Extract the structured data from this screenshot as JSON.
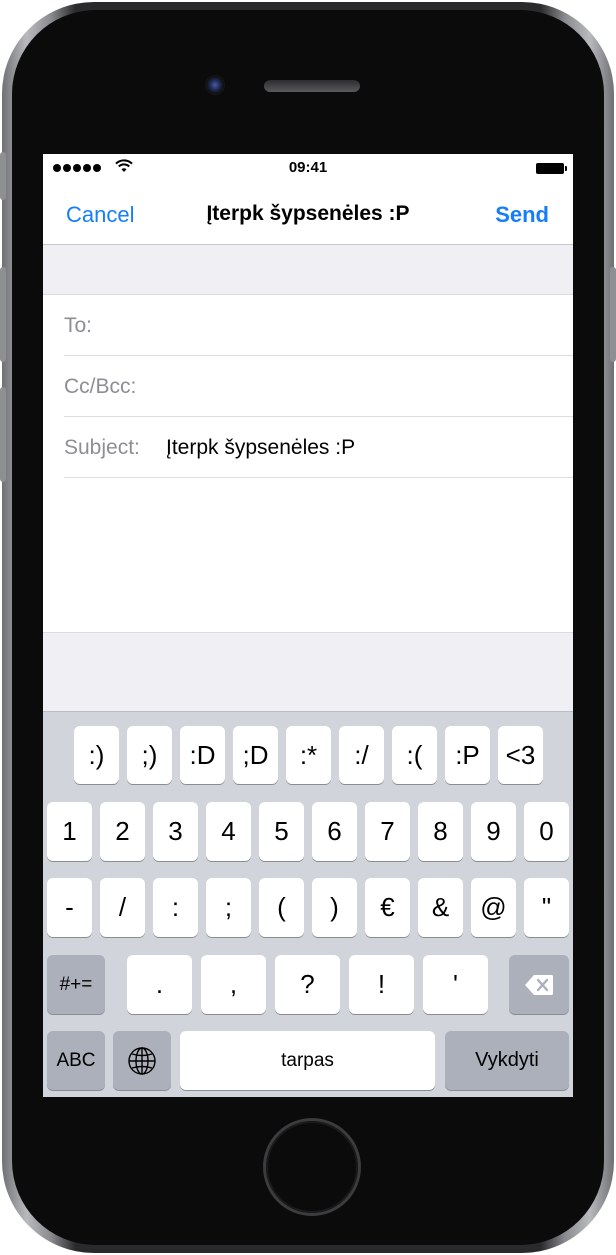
{
  "status_bar": {
    "time": "09:41"
  },
  "nav": {
    "cancel": "Cancel",
    "title": "Įterpk šypsenėles :P",
    "send": "Send"
  },
  "fields": [
    {
      "label": "To:",
      "value": ""
    },
    {
      "label": "Cc/Bcc:",
      "value": ""
    },
    {
      "label": "Subject:",
      "value": "Įterpk šypsenėles :P"
    }
  ],
  "keyboard": {
    "emoticons": [
      ":)",
      ";)",
      ":D",
      ";D",
      ":*",
      ":/",
      ":(",
      ":P",
      "<3"
    ],
    "row1": [
      "1",
      "2",
      "3",
      "4",
      "5",
      "6",
      "7",
      "8",
      "9",
      "0"
    ],
    "row2": [
      "-",
      "/",
      ":",
      ";",
      "(",
      ")",
      "€",
      "&",
      "@",
      "\""
    ],
    "row3": [
      ".",
      ",",
      "?",
      "!",
      "'"
    ],
    "symbols_key": "#+=",
    "abc_key": "ABC",
    "space_key": "tarpas",
    "return_key": "Vykdyti"
  },
  "colors": {
    "accent": "#157efb",
    "keyboard_bg": "#d1d5db",
    "dark_key": "#abb0ba"
  },
  "icons": [
    "signal-dots-icon",
    "wifi-icon",
    "battery-icon",
    "globe-icon",
    "backspace-icon"
  ]
}
